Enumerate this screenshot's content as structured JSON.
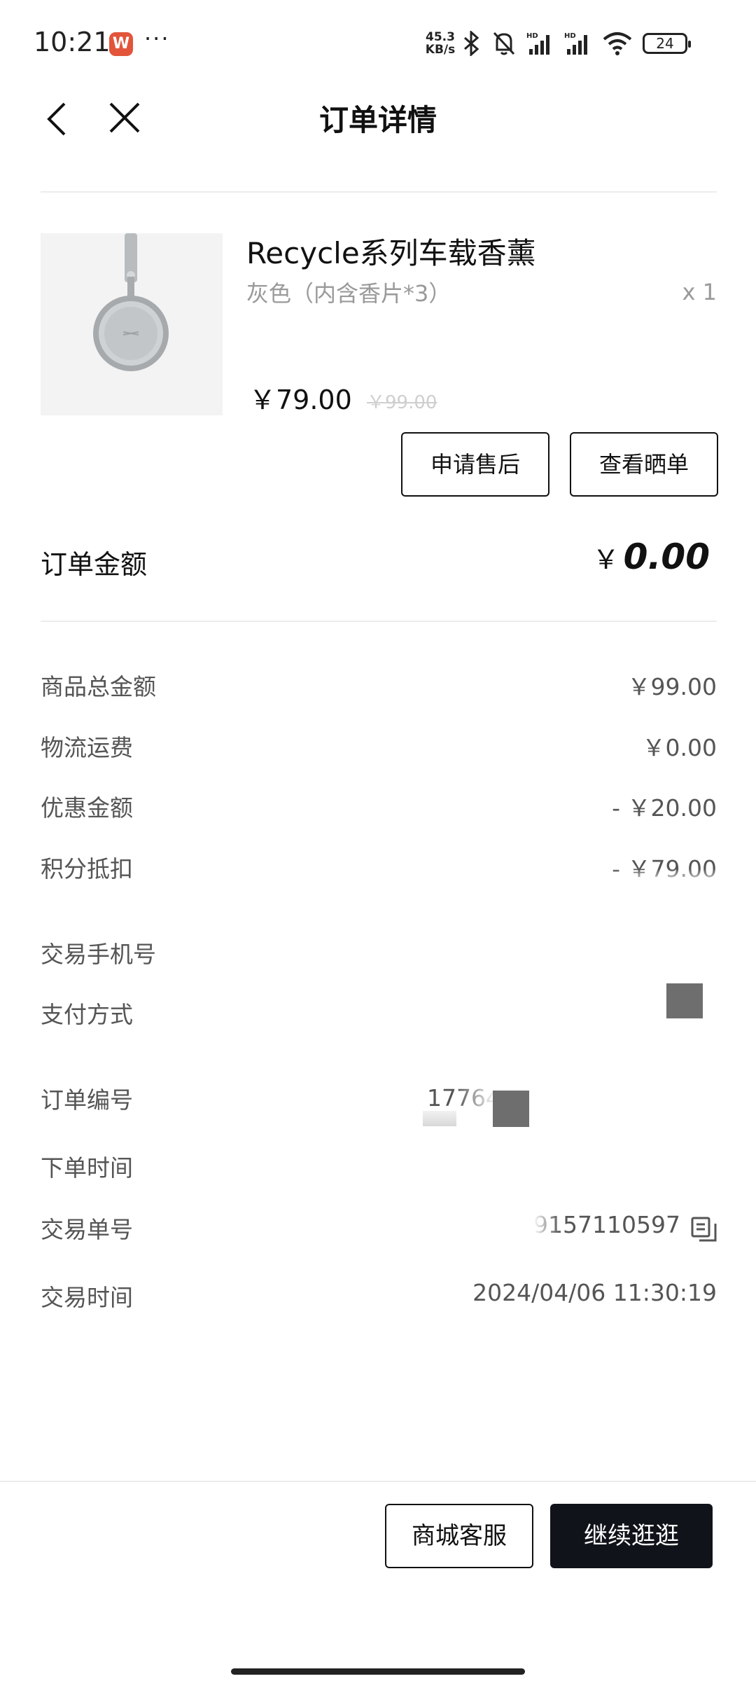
{
  "status_bar": {
    "time": "10:21",
    "app_badge": "W",
    "more": "···",
    "net_speed_value": "45.3",
    "net_speed_unit": "KB/s",
    "battery": "24",
    "icons": [
      "bluetooth-icon",
      "bell-muted-icon",
      "signal-hd-icon",
      "signal-hd-icon",
      "wifi-icon",
      "battery-icon"
    ]
  },
  "header": {
    "title": "订单详情"
  },
  "product": {
    "name": "Recycle系列车载香薰",
    "variant": "灰色（内含香片*3）",
    "quantity": "x 1",
    "price": "￥79.00",
    "original_price": "￥99.00"
  },
  "actions": {
    "after_sales": "申请售后",
    "view_review": "查看晒单"
  },
  "order_amount": {
    "label": "订单金额",
    "currency": "￥",
    "value": "0.00"
  },
  "details": {
    "goods_total_label": "商品总金额",
    "goods_total_value": "￥99.00",
    "shipping_label": "物流运费",
    "shipping_value": "￥0.00",
    "discount_label": "优惠金额",
    "discount_value": "- ￥20.00",
    "points_label": "积分抵扣",
    "points_value": "- ￥79.00",
    "phone_label": "交易手机号",
    "payment_label": "支付方式",
    "order_no_label": "订单编号",
    "order_no_value": "17764",
    "order_time_label": "下单时间",
    "trade_no_label": "交易单号",
    "trade_no_value": "9157110597",
    "trade_time_label": "交易时间",
    "trade_time_value": "2024/04/06 11:30:19"
  },
  "footer": {
    "service": "商城客服",
    "continue": "继续逛逛"
  },
  "colors": {
    "primary_dark": "#11131a",
    "muted_text": "#9a9a9a",
    "divider": "#ececec"
  }
}
